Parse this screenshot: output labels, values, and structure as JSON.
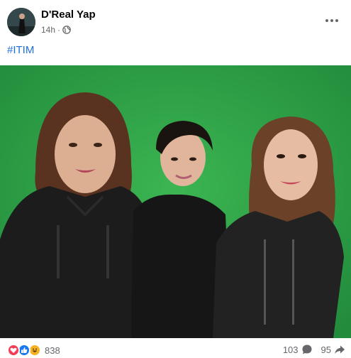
{
  "post": {
    "author": "D'Real Yap",
    "time": "14h",
    "separator": "·",
    "privacy_icon": "globe-icon",
    "more_icon": "more-options-icon",
    "caption": "#ITIM"
  },
  "photo": {
    "background_color": "#2fa048"
  },
  "footer": {
    "reaction_icons": [
      "love-icon",
      "like-icon",
      "haha-icon"
    ],
    "reaction_count": "838",
    "comment_count": "103",
    "share_count": "95"
  },
  "colors": {
    "hashtag": "#216fdb",
    "secondary_text": "#65676b",
    "love": "#f33e58",
    "like": "#1877f2",
    "haha": "#f7b125"
  }
}
